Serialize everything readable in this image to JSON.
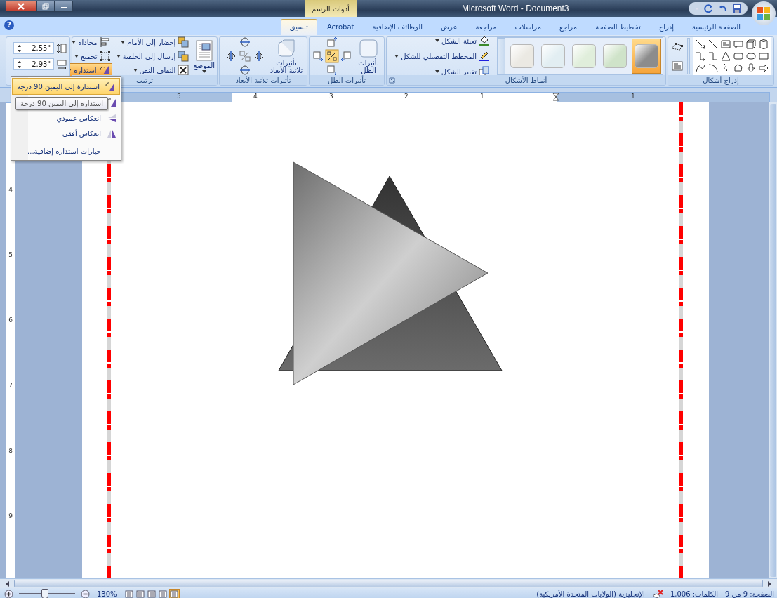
{
  "window": {
    "title": "Microsoft Word - Document3",
    "context_label": "أدوات الرسم"
  },
  "help": "?",
  "tabs": [
    {
      "label": "الصفحة الرئيسية",
      "selected": false
    },
    {
      "label": "إدراج",
      "selected": false
    },
    {
      "label": "تخطيط الصفحة",
      "selected": false
    },
    {
      "label": "مراجع",
      "selected": false
    },
    {
      "label": "مراسلات",
      "selected": false
    },
    {
      "label": "مراجعة",
      "selected": false
    },
    {
      "label": "عرض",
      "selected": false
    },
    {
      "label": "الوظائف الإضافية",
      "selected": false
    },
    {
      "label": "Acrobat",
      "selected": false
    },
    {
      "label": "تنسيق",
      "selected": true
    }
  ],
  "ribbon": {
    "insert_shapes": {
      "label": "إدراج أشكال"
    },
    "shape_styles": {
      "label": "أنماط الأشكال",
      "styles": [
        {
          "color": "#8c8c8c",
          "selected": true
        },
        {
          "color": "#cfe3c9",
          "selected": false
        },
        {
          "color": "#e0eedb",
          "selected": false
        },
        {
          "color": "#e2eef2",
          "selected": false
        },
        {
          "color": "#ebe9e3",
          "selected": false
        }
      ],
      "commands": [
        "تعبئة الشكل",
        "المخطط التفصيلي للشكل",
        "تغيير الشكل"
      ]
    },
    "shadow": {
      "label": "تأثيرات الظل",
      "button": "تأثيرات الظل"
    },
    "effects_3d": {
      "label": "تأثيرات ثلاثية الأبعاد",
      "button": "تأثيرات ثلاثية الأبعاد"
    },
    "arrange": {
      "label": "ترتيب",
      "position": "الموضع",
      "commands": [
        {
          "label": "إحضار إلى الأمام",
          "pressed": false
        },
        {
          "label": "إرسال إلى الخلفية",
          "pressed": false
        },
        {
          "label": "التفاف النص",
          "pressed": false
        },
        {
          "label": "محاذاة",
          "pressed": false
        },
        {
          "label": "تجميع",
          "pressed": false
        },
        {
          "label": "استدارة",
          "pressed": true
        }
      ]
    },
    "size": {
      "height": "2.55\"",
      "width": "2.93\""
    }
  },
  "rotate_menu": {
    "items": [
      {
        "label": "استدارة إلى اليمين 90 درجة",
        "selected": true
      },
      {
        "selected": false
      },
      {
        "label": "انعكاس عمودي",
        "selected": false
      },
      {
        "label": "انعكاس أفقي",
        "selected": false
      },
      {
        "label": "خيارات استدارة إضافية...",
        "selected": false
      }
    ],
    "tooltip": "استدارة إلى اليمين 90 درجة"
  },
  "ruler": {
    "horizontal": [
      "1",
      "1",
      "2",
      "3",
      "4",
      "5"
    ],
    "vertical": [
      "4",
      "5",
      "6",
      "7",
      "8",
      "9"
    ]
  },
  "status_bar": {
    "page": "الصفحة: 9 من 9",
    "words": "الكلمات: 1,006",
    "language": "الإنجليزية (الولايات المتحدة الأمريكية)",
    "zoom": "130%",
    "zoom_slider": {
      "level": 0.45
    },
    "views": [
      {
        "selected": false
      },
      {
        "selected": false
      },
      {
        "selected": false
      },
      {
        "selected": false
      },
      {
        "selected": true
      }
    ]
  }
}
